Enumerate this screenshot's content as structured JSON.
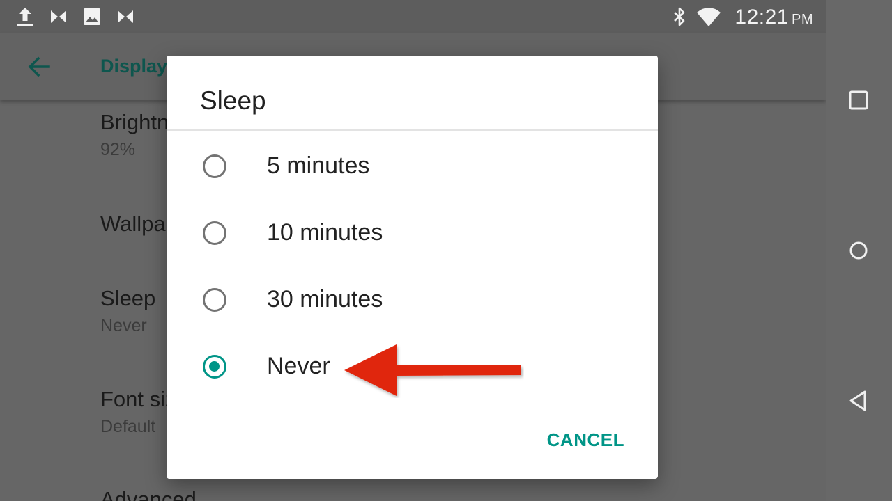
{
  "status_bar": {
    "left_icons": [
      "upload-icon",
      "bow-tie-icon",
      "image-icon",
      "bow-tie-icon"
    ],
    "right_icons": [
      "bluetooth-icon",
      "wifi-icon"
    ],
    "time": "12:21",
    "ampm": "PM"
  },
  "app_bar": {
    "title": "Display",
    "back_icon": "arrow-back-icon"
  },
  "settings": [
    {
      "title": "Brightness level",
      "summary": "92%"
    },
    {
      "title": "Wallpaper",
      "summary": ""
    },
    {
      "title": "Sleep",
      "summary": "Never"
    },
    {
      "title": "Font size",
      "summary": "Default"
    },
    {
      "title": "Advanced",
      "summary": ""
    }
  ],
  "dialog": {
    "title": "Sleep",
    "options": [
      {
        "label": "5 minutes",
        "selected": false
      },
      {
        "label": "10 minutes",
        "selected": false
      },
      {
        "label": "30 minutes",
        "selected": false
      },
      {
        "label": "Never",
        "selected": true
      }
    ],
    "cancel_label": "CANCEL"
  },
  "annotation": {
    "arrow_color": "#e0260d"
  },
  "nav_bar": {
    "icons": [
      "recents-square-icon",
      "home-circle-icon",
      "back-triangle-icon"
    ]
  },
  "colors": {
    "accent": "#009587",
    "title_teal": "#0e564e",
    "scrim_bg": "#666666"
  }
}
